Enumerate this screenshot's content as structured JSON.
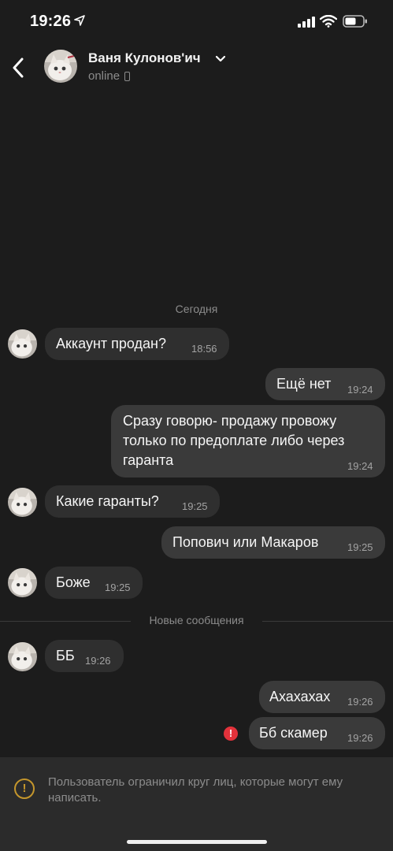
{
  "status_bar": {
    "time": "19:26"
  },
  "header": {
    "contact_name": "Ваня Кулонов'ич",
    "status": "online"
  },
  "date_separator": "Сегодня",
  "new_messages_label": "Новые сообщения",
  "messages": [
    {
      "direction": "in",
      "text": "Аккаунт продан?",
      "time": "18:56"
    },
    {
      "direction": "out",
      "text": "Ещё нет",
      "time": "19:24"
    },
    {
      "direction": "out",
      "text": "Сразу говорю- продажу провожу\nтолько по предоплате либо через\nгаранта",
      "time": "19:24"
    },
    {
      "direction": "in",
      "text": "Какие гаранты?",
      "time": "19:25"
    },
    {
      "direction": "out",
      "text": "Попович или Макаров",
      "time": "19:25"
    },
    {
      "direction": "in",
      "text": "Боже",
      "time": "19:25"
    },
    {
      "direction": "in",
      "text": "ББ",
      "time": "19:26"
    },
    {
      "direction": "out",
      "text": "Ахахахах",
      "time": "19:26"
    },
    {
      "direction": "out",
      "text": "Бб скамер",
      "time": "19:26",
      "failed": true
    }
  ],
  "error_icon": "!",
  "footer": {
    "warning_icon": "!",
    "text": "Пользователь ограничил круг лиц, которые могут ему написать."
  },
  "colors": {
    "background": "#1c1c1c",
    "bubble_out": "#3a3a3a",
    "bubble_in": "#2f2f2f",
    "error": "#e2323b",
    "warning": "#c4962c"
  }
}
